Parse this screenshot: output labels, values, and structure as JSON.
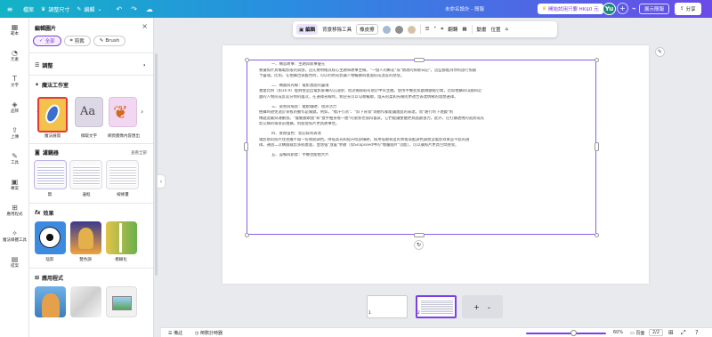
{
  "topbar": {
    "file": "檔案",
    "resize": "調整尺寸",
    "edit": "編輯",
    "doc_title": "未命名設計 - 簡報",
    "pro": "開始試用只要 HK$0 元",
    "avatar": "Yu",
    "present": "展示簡報",
    "share": "分享"
  },
  "rail": [
    {
      "icon": "▦",
      "label": "範本"
    },
    {
      "icon": "◔",
      "label": "元素"
    },
    {
      "icon": "T",
      "label": "文字"
    },
    {
      "icon": "◈",
      "label": "品牌"
    },
    {
      "icon": "⇪",
      "label": "上傳"
    },
    {
      "icon": "✎",
      "label": "工具"
    },
    {
      "icon": "▣",
      "label": "專案"
    },
    {
      "icon": "⊞",
      "label": "應用程式"
    },
    {
      "icon": "✧",
      "label": "魔法媒體工具"
    },
    {
      "icon": "▤",
      "label": "提案"
    }
  ],
  "panel": {
    "header": "編輯圖片",
    "tabs": [
      "全部",
      "剪裁",
      "Brush"
    ],
    "adjust": "調整",
    "magic_studio": "魔法工作室",
    "magic_items": [
      "魔法展開",
      "擷取文字",
      "網頁圖像內容匯出"
    ],
    "filters": "濾鏡器",
    "see_all": "查看全部",
    "filter_items": [
      "無",
      "邊框",
      "線條畫"
    ],
    "effects": "效果",
    "effect_items": [
      "陰影",
      "雙色調",
      "模糊化"
    ],
    "apps": "應用程式"
  },
  "context_toolbar": {
    "edit": "編輯",
    "bg_remove": "背景移除工具",
    "flip": "翻轉",
    "animate": "動畫",
    "position": "位置",
    "swatches": [
      "#a7b9d4",
      "#8f8f92",
      "#d6c3a6"
    ]
  },
  "document": {
    "lines": [
      {
        "cls": "h",
        "text": "一、構思故事：主題與敘事優先"
      },
      {
        "cls": "p",
        "text": "要讓照片具備電影般的質感，首先要明確其核心主題和故事主線。\"一個人的郵差\"或\"閒適的探險日記\"，這些都能為你的旅行照賦"
      },
      {
        "cls": "p",
        "text": "予靈魂。比如，在拍攝古城舊色時，可以利用光影讓人物輪廓與畫面形成溫差的感受。"
      },
      {
        "cls": "h",
        "text": "二、構圖與光線：電影畫面的靈魂"
      },
      {
        "cls": "p",
        "text": "寬螢比例（如16:9）能夠營造出電影屏幕的沉浸感；而流暢採取有助於中央主體。使用手機長焦鏡頭壓縮空間，比如拍攝的山脈和近"
      },
      {
        "cls": "p",
        "text": "處的人物形成反差分明的層次，在選擇光線時，側逆光可以勾勒輪廓，陰天的柔和光線則更適合表達情緒的理想選擇。"
      },
      {
        "cls": "h",
        "text": "三、姿勢與場景：擺脫僵硬、增添活力"
      },
      {
        "cls": "p",
        "text": "拍攝時避免過於呆板的動作是關鍵。例如，\"擦汗行為\"、\"斜下背景\"等動作都能讓畫面的表達。而\"路行時下透鏡\"則"
      },
      {
        "cls": "p",
        "text": "傳遞遮蔽與運動感。\"擺動鏡頭畫\"和\"雙手抽身看一圈\"的姿勢也值得嘗試，它們能讓整體更具戲劇張力。此外，在打鑽透視的道具或光"
      },
      {
        "cls": "p",
        "text": "影交織的場景前拍攝，則能使照片更具故事性。"
      },
      {
        "cls": "h",
        "text": "四、後期強色：從記錄到表達"
      },
      {
        "cls": "p",
        "text": "電影感的照片往往離不開一份後期調色。降低高光和提升暗部細節，採用低飽和度的青橙或藍調色調營造電影效果是不錯的選"
      },
      {
        "cls": "p",
        "text": "擇。通過二次構圖裁剪多餘畫面，並增強\"放置\"參數（如Snapseed中的\"曝量圖片\"功能），可以讓照片更具空間感受。"
      },
      {
        "cls": "h",
        "text": "五、設備與創意：手機也能拍大片"
      }
    ]
  },
  "pages": [
    "1",
    "2"
  ],
  "bottombar": {
    "notes": "備註",
    "timer": "倒數計時器",
    "zoom": "60%",
    "view": "頁面",
    "page_count": "2/2"
  }
}
